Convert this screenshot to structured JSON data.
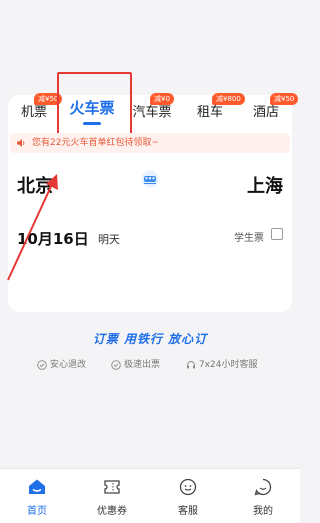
{
  "tabs": [
    {
      "label": "机票",
      "badge": "减¥50"
    },
    {
      "label": "火车票",
      "badge": ""
    },
    {
      "label": "汽车票",
      "badge": "减¥0"
    },
    {
      "label": "租车",
      "badge": "减¥800"
    },
    {
      "label": "酒店",
      "badge": "减¥50"
    }
  ],
  "active_tab": "火车票",
  "notice": {
    "text": "您有22元火车首单红包待领取~",
    "icon": "speaker-icon"
  },
  "route": {
    "from": "北京",
    "to": "上海",
    "swap_icon": "train-swap-icon"
  },
  "date": {
    "value": "10月16日",
    "relative": "明天"
  },
  "student_ticket": {
    "label": "学生票",
    "checked": false
  },
  "slogan": "订票 用铁行 放心订",
  "features": [
    {
      "icon": "shield-check-icon",
      "label": "安心退改"
    },
    {
      "icon": "clock-icon",
      "label": "极速出票"
    },
    {
      "icon": "headset-icon",
      "label": "7x24小时客服"
    }
  ],
  "bottom_nav": [
    {
      "label": "首页",
      "icon": "home-icon",
      "active": true
    },
    {
      "label": "优惠券",
      "icon": "coupon-icon",
      "active": false
    },
    {
      "label": "客服",
      "icon": "service-icon",
      "active": false
    },
    {
      "label": "我的",
      "icon": "profile-icon",
      "active": false
    }
  ],
  "colors": {
    "accent": "#1f6fe8",
    "badge": "#ff5a2c",
    "annotation": "#e53935"
  }
}
